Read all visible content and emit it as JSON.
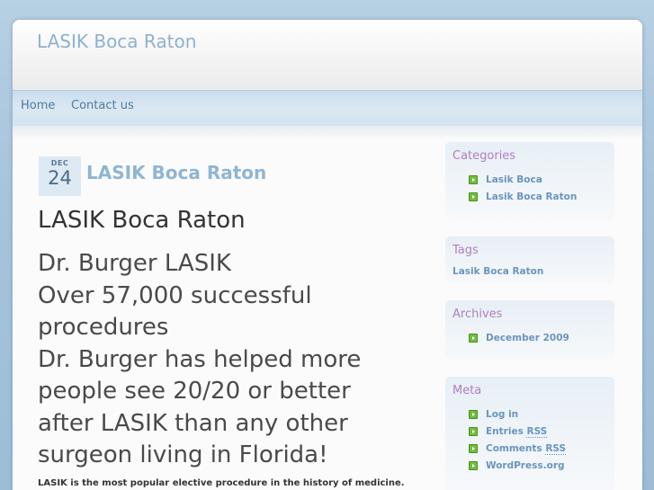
{
  "site": {
    "title": "LASIK Boca Raton"
  },
  "nav": {
    "items": [
      {
        "label": "Home"
      },
      {
        "label": "Contact us"
      }
    ]
  },
  "post": {
    "date_month": "DEC",
    "date_day": "24",
    "title": "LASIK Boca Raton",
    "heading1": "LASIK Boca Raton",
    "heading2_lines": [
      "Dr. Burger LASIK",
      "Over 57,000 successful",
      "procedures",
      "Dr. Burger has helped more",
      "people see 20/20 or better",
      "after LASIK than any other",
      "surgeon living in Florida!"
    ],
    "lead_text": "LASIK is the most popular elective procedure in the history of medicine."
  },
  "sidebar": {
    "categories": {
      "title": "Categories",
      "items": [
        "Lasik Boca",
        "Lasik Boca Raton"
      ]
    },
    "tags": {
      "title": "Tags",
      "items": [
        "Lasik Boca Raton"
      ]
    },
    "archives": {
      "title": "Archives",
      "items": [
        "December 2009"
      ]
    },
    "meta": {
      "title": "Meta",
      "login": "Log in",
      "entries_prefix": "Entries ",
      "comments_prefix": "Comments ",
      "rss": "RSS",
      "wordpress": "WordPress.org"
    }
  },
  "colors": {
    "accent_title": "#8fb1ce",
    "widget_heading": "#b07fc0",
    "link": "#6a95bd",
    "bullet": "#6fbf3a"
  }
}
